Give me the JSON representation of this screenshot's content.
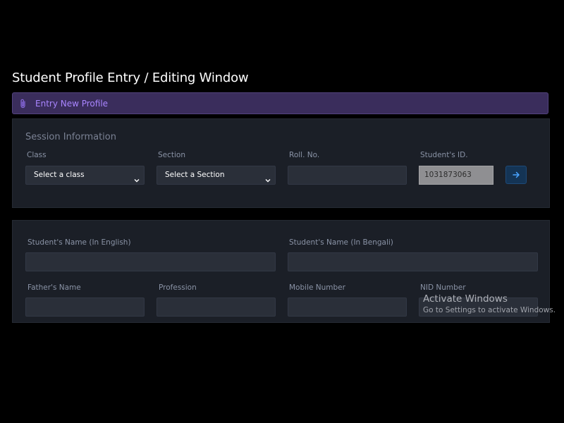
{
  "page": {
    "title": "Student Profile Entry / Editing Window"
  },
  "banner": {
    "label": "Entry New Profile",
    "icon": "paperclip-icon",
    "accent": "#a985ff"
  },
  "session": {
    "heading": "Session Information",
    "class_label": "Class",
    "class_value": "Select a class",
    "section_label": "Section",
    "section_value": "Select a Section",
    "roll_label": "Roll. No.",
    "roll_value": "",
    "student_id_label": "Student's ID.",
    "student_id_value": "1031873063",
    "go_icon": "arrow-right-icon"
  },
  "student": {
    "name_en_label": "Student's Name (In English)",
    "name_bn_label": "Student's Name (In Bengali)",
    "father_label": "Father's Name",
    "profession_label": "Profession",
    "mobile_label": "Mobile Number",
    "nid_label": "NID Number"
  },
  "watermark": {
    "title": "Activate Windows",
    "subtitle": "Go to Settings to activate Windows."
  },
  "colors": {
    "background": "#000000",
    "card": "#1b1f27",
    "input": "#2a2f39",
    "banner": "#3a2d5c",
    "button": "#143455"
  }
}
